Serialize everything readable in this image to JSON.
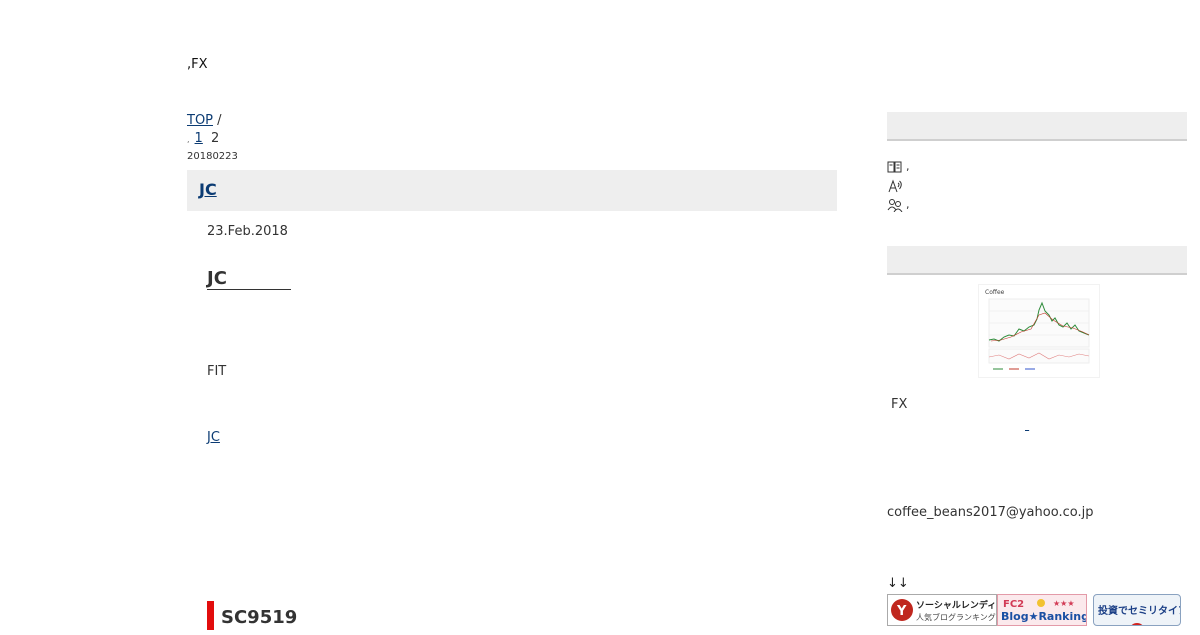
{
  "blog": {
    "title": ",FX"
  },
  "breadcrumb": {
    "home": "TOP",
    "separator": "/"
  },
  "pager": {
    "sep": ",",
    "page1": "1",
    "page2": "2"
  },
  "entry": {
    "date_small": "20180223",
    "header_title": "JC",
    "date": "23.Feb.2018",
    "heading": "JC",
    "text": "FIT",
    "link": "JC"
  },
  "section": {
    "title": "SC9519"
  },
  "sidebar": {
    "list": [
      {
        "icon": "book-icon",
        "text": ","
      },
      {
        "icon": "signal-icon",
        "link": ""
      },
      {
        "icon": "people-icon",
        "text": ","
      }
    ],
    "chart_title": "Coffee",
    "profile_fx": "FX",
    "email": "coffee_beans2017@yahoo.co.jp",
    "arrows": "↓↓",
    "banners": {
      "social_lending_top": "ソーシャルレンディング",
      "social_lending_bottom": "人気ブログランキング",
      "fc2_top": "FC2",
      "fc2_bottom": "Blog★Ranking",
      "semiretire": "投資でセミリタイア生活"
    }
  },
  "colors": {
    "accent": "#e20d0d",
    "link": "#0b3b73",
    "header_bg": "#eeeeee"
  }
}
